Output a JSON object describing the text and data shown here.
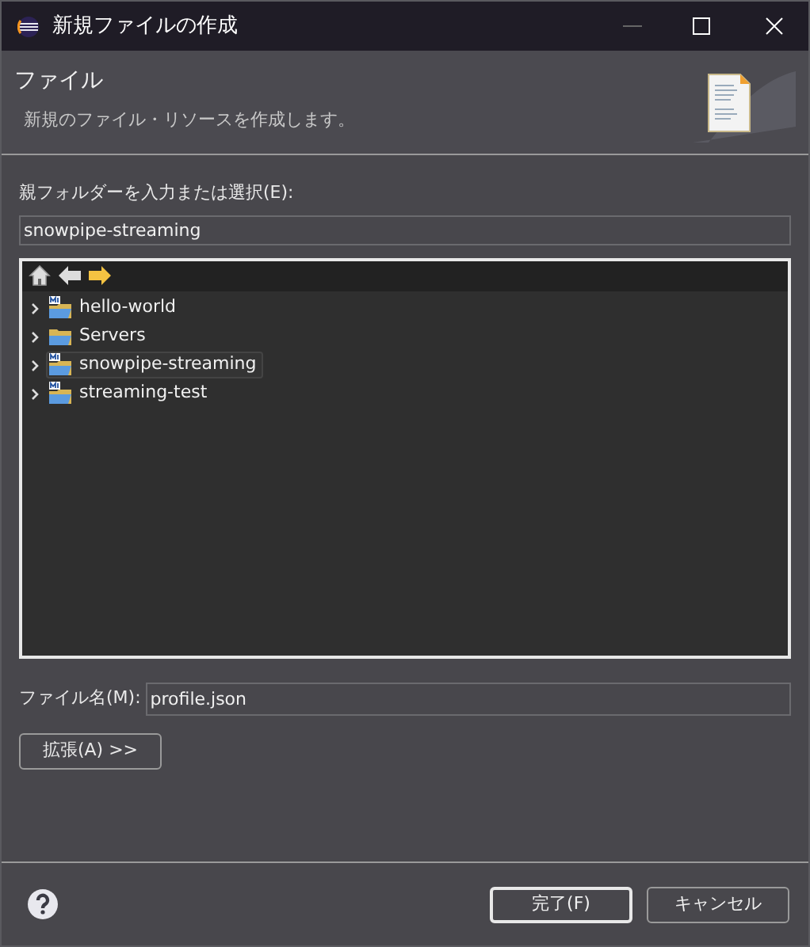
{
  "window": {
    "title": "新規ファイルの作成"
  },
  "header": {
    "title": "ファイル",
    "description": "新規のファイル・リソースを作成します。"
  },
  "parent_folder": {
    "label": "親フォルダーを入力または選択(E):",
    "value": "snowpipe-streaming"
  },
  "tree": {
    "items": [
      {
        "label": "hello-world",
        "kind": "project",
        "selected": false,
        "expanded": false
      },
      {
        "label": "Servers",
        "kind": "folder",
        "selected": false,
        "expanded": false
      },
      {
        "label": "snowpipe-streaming",
        "kind": "project",
        "selected": true,
        "expanded": false
      },
      {
        "label": "streaming-test",
        "kind": "project",
        "selected": false,
        "expanded": false
      }
    ]
  },
  "file_name": {
    "label": "ファイル名(M):",
    "value": "profile.json"
  },
  "advanced_button": "拡張(A) >>",
  "buttons": [
    {
      "label": "完了(F)",
      "default": true
    },
    {
      "label": "キャンセル",
      "default": false
    }
  ]
}
